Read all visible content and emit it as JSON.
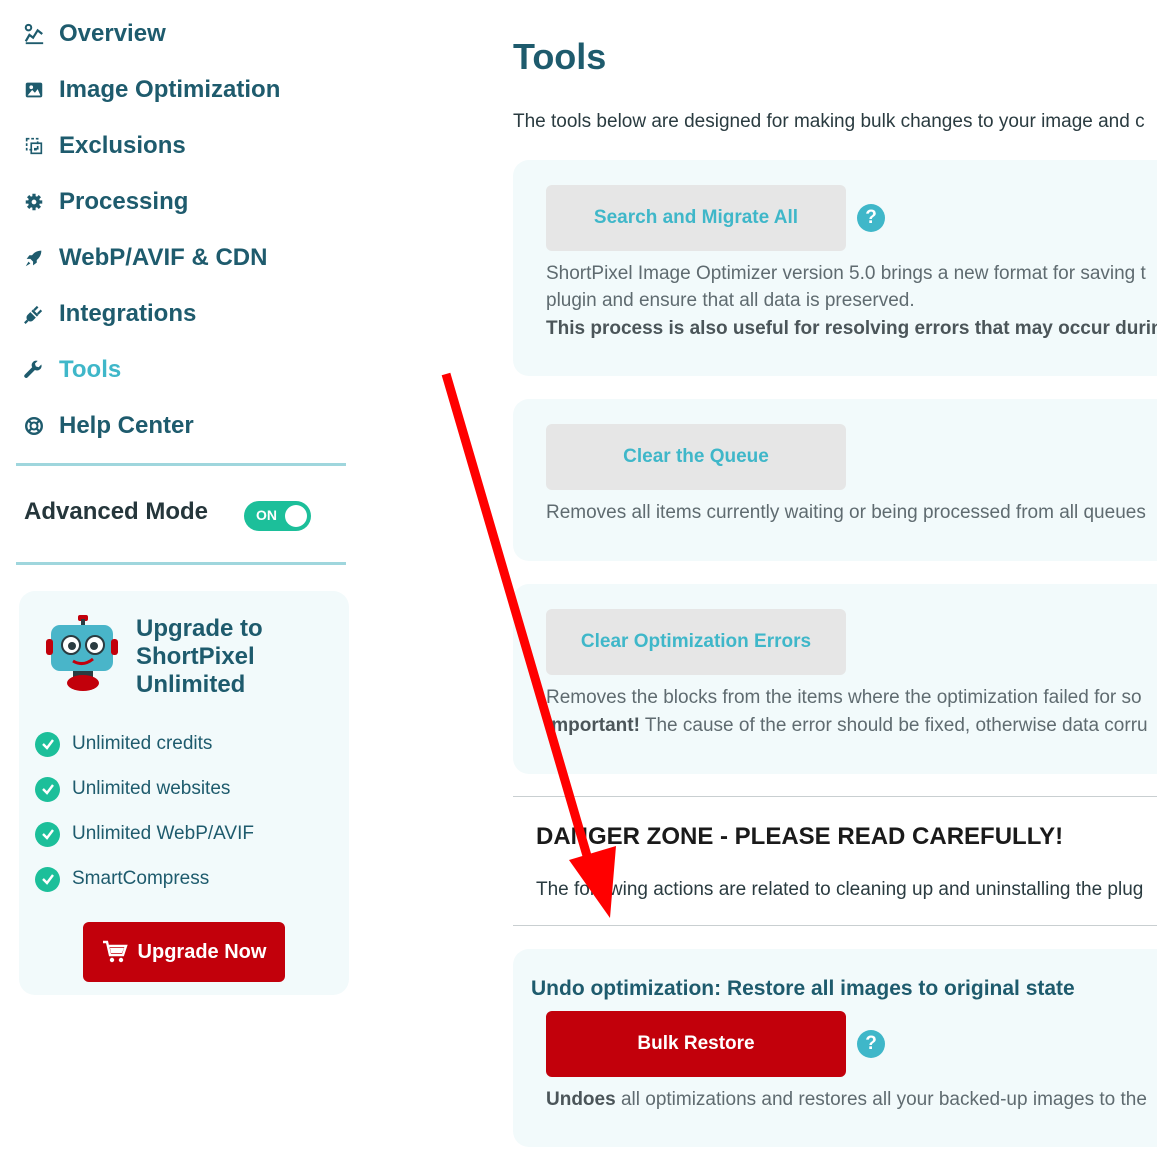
{
  "sidebar": {
    "items": [
      {
        "label": "Overview",
        "icon": "chart-icon"
      },
      {
        "label": "Image Optimization",
        "icon": "image-icon"
      },
      {
        "label": "Exclusions",
        "icon": "exclusions-icon"
      },
      {
        "label": "Processing",
        "icon": "gear-icon"
      },
      {
        "label": "WebP/AVIF & CDN",
        "icon": "rocket-icon"
      },
      {
        "label": "Integrations",
        "icon": "plug-icon"
      },
      {
        "label": "Tools",
        "icon": "wrench-icon"
      },
      {
        "label": "Help Center",
        "icon": "lifebuoy-icon"
      }
    ],
    "active": "Tools",
    "advanced_mode": {
      "label": "Advanced Mode",
      "state": "ON"
    }
  },
  "upgrade": {
    "title": "Upgrade to ShortPixel Unlimited",
    "features": [
      "Unlimited credits",
      "Unlimited websites",
      "Unlimited WebP/AVIF",
      "SmartCompress"
    ],
    "button": "Upgrade Now"
  },
  "main": {
    "title": "Tools",
    "intro": "The tools below are designed for making bulk changes to your image and c",
    "tools": [
      {
        "button": "Search and Migrate All",
        "desc_lines": [
          "ShortPixel Image Optimizer version 5.0 brings a new format for saving t",
          "plugin and ensure that all data is preserved."
        ],
        "desc_bold": "This process is also useful for resolving errors that may occur during c"
      },
      {
        "button": "Clear the Queue",
        "desc": "Removes all items currently waiting or being processed from all queues"
      },
      {
        "button": "Clear Optimization Errors",
        "desc": "Removes the blocks from the items where the optimization failed for so",
        "important_bold": "Important!",
        "important_rest": " The cause of the error should be fixed, otherwise data corru"
      }
    ],
    "danger": {
      "title": "DANGER ZONE - PLEASE READ CAREFULLY!",
      "desc": "The following actions are related to cleaning up and uninstalling the plug"
    },
    "undo": {
      "title": "Undo optimization: Restore all images to original state",
      "button": "Bulk Restore",
      "desc_bold": "Undoes",
      "desc_rest": " all optimizations and restores all your backed-up images to the"
    }
  },
  "help_label": "?",
  "colors": {
    "primary": "#1e5b6d",
    "accent": "#3fb7c9",
    "toggle_on": "#1cbf9a",
    "danger_red": "#c2000b",
    "card_bg": "#f2fafb",
    "annotation_arrow": "#ff0000"
  }
}
